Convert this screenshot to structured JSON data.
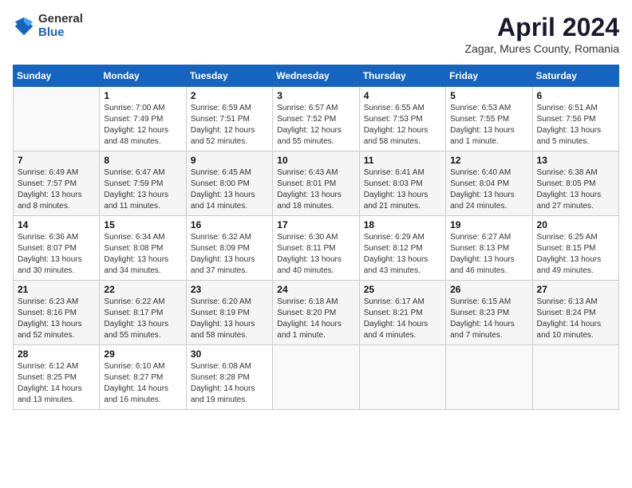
{
  "logo": {
    "general": "General",
    "blue": "Blue"
  },
  "title": "April 2024",
  "subtitle": "Zagar, Mures County, Romania",
  "calendar": {
    "headers": [
      "Sunday",
      "Monday",
      "Tuesday",
      "Wednesday",
      "Thursday",
      "Friday",
      "Saturday"
    ],
    "weeks": [
      [
        {
          "day": "",
          "info": ""
        },
        {
          "day": "1",
          "info": "Sunrise: 7:00 AM\nSunset: 7:49 PM\nDaylight: 12 hours\nand 48 minutes."
        },
        {
          "day": "2",
          "info": "Sunrise: 6:59 AM\nSunset: 7:51 PM\nDaylight: 12 hours\nand 52 minutes."
        },
        {
          "day": "3",
          "info": "Sunrise: 6:57 AM\nSunset: 7:52 PM\nDaylight: 12 hours\nand 55 minutes."
        },
        {
          "day": "4",
          "info": "Sunrise: 6:55 AM\nSunset: 7:53 PM\nDaylight: 12 hours\nand 58 minutes."
        },
        {
          "day": "5",
          "info": "Sunrise: 6:53 AM\nSunset: 7:55 PM\nDaylight: 13 hours\nand 1 minute."
        },
        {
          "day": "6",
          "info": "Sunrise: 6:51 AM\nSunset: 7:56 PM\nDaylight: 13 hours\nand 5 minutes."
        }
      ],
      [
        {
          "day": "7",
          "info": "Sunrise: 6:49 AM\nSunset: 7:57 PM\nDaylight: 13 hours\nand 8 minutes."
        },
        {
          "day": "8",
          "info": "Sunrise: 6:47 AM\nSunset: 7:59 PM\nDaylight: 13 hours\nand 11 minutes."
        },
        {
          "day": "9",
          "info": "Sunrise: 6:45 AM\nSunset: 8:00 PM\nDaylight: 13 hours\nand 14 minutes."
        },
        {
          "day": "10",
          "info": "Sunrise: 6:43 AM\nSunset: 8:01 PM\nDaylight: 13 hours\nand 18 minutes."
        },
        {
          "day": "11",
          "info": "Sunrise: 6:41 AM\nSunset: 8:03 PM\nDaylight: 13 hours\nand 21 minutes."
        },
        {
          "day": "12",
          "info": "Sunrise: 6:40 AM\nSunset: 8:04 PM\nDaylight: 13 hours\nand 24 minutes."
        },
        {
          "day": "13",
          "info": "Sunrise: 6:38 AM\nSunset: 8:05 PM\nDaylight: 13 hours\nand 27 minutes."
        }
      ],
      [
        {
          "day": "14",
          "info": "Sunrise: 6:36 AM\nSunset: 8:07 PM\nDaylight: 13 hours\nand 30 minutes."
        },
        {
          "day": "15",
          "info": "Sunrise: 6:34 AM\nSunset: 8:08 PM\nDaylight: 13 hours\nand 34 minutes."
        },
        {
          "day": "16",
          "info": "Sunrise: 6:32 AM\nSunset: 8:09 PM\nDaylight: 13 hours\nand 37 minutes."
        },
        {
          "day": "17",
          "info": "Sunrise: 6:30 AM\nSunset: 8:11 PM\nDaylight: 13 hours\nand 40 minutes."
        },
        {
          "day": "18",
          "info": "Sunrise: 6:29 AM\nSunset: 8:12 PM\nDaylight: 13 hours\nand 43 minutes."
        },
        {
          "day": "19",
          "info": "Sunrise: 6:27 AM\nSunset: 8:13 PM\nDaylight: 13 hours\nand 46 minutes."
        },
        {
          "day": "20",
          "info": "Sunrise: 6:25 AM\nSunset: 8:15 PM\nDaylight: 13 hours\nand 49 minutes."
        }
      ],
      [
        {
          "day": "21",
          "info": "Sunrise: 6:23 AM\nSunset: 8:16 PM\nDaylight: 13 hours\nand 52 minutes."
        },
        {
          "day": "22",
          "info": "Sunrise: 6:22 AM\nSunset: 8:17 PM\nDaylight: 13 hours\nand 55 minutes."
        },
        {
          "day": "23",
          "info": "Sunrise: 6:20 AM\nSunset: 8:19 PM\nDaylight: 13 hours\nand 58 minutes."
        },
        {
          "day": "24",
          "info": "Sunrise: 6:18 AM\nSunset: 8:20 PM\nDaylight: 14 hours\nand 1 minute."
        },
        {
          "day": "25",
          "info": "Sunrise: 6:17 AM\nSunset: 8:21 PM\nDaylight: 14 hours\nand 4 minutes."
        },
        {
          "day": "26",
          "info": "Sunrise: 6:15 AM\nSunset: 8:23 PM\nDaylight: 14 hours\nand 7 minutes."
        },
        {
          "day": "27",
          "info": "Sunrise: 6:13 AM\nSunset: 8:24 PM\nDaylight: 14 hours\nand 10 minutes."
        }
      ],
      [
        {
          "day": "28",
          "info": "Sunrise: 6:12 AM\nSunset: 8:25 PM\nDaylight: 14 hours\nand 13 minutes."
        },
        {
          "day": "29",
          "info": "Sunrise: 6:10 AM\nSunset: 8:27 PM\nDaylight: 14 hours\nand 16 minutes."
        },
        {
          "day": "30",
          "info": "Sunrise: 6:08 AM\nSunset: 8:28 PM\nDaylight: 14 hours\nand 19 minutes."
        },
        {
          "day": "",
          "info": ""
        },
        {
          "day": "",
          "info": ""
        },
        {
          "day": "",
          "info": ""
        },
        {
          "day": "",
          "info": ""
        }
      ]
    ]
  }
}
